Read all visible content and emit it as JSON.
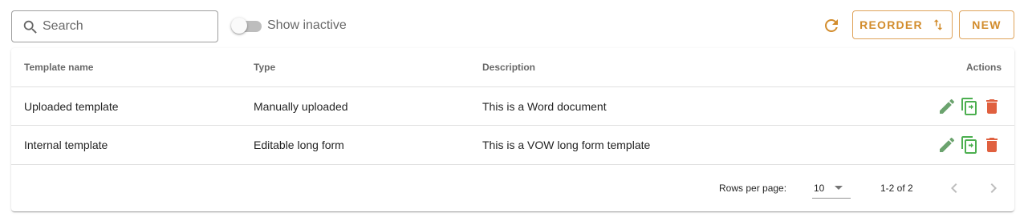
{
  "toolbar": {
    "search_placeholder": "Search",
    "search_value": "",
    "show_inactive_label": "Show inactive",
    "show_inactive_on": false,
    "reorder_label": "REORDER",
    "new_label": "NEW"
  },
  "table": {
    "columns": [
      "Template name",
      "Type",
      "Description",
      "Actions"
    ],
    "rows": [
      {
        "name": "Uploaded template",
        "type": "Manually uploaded",
        "description": "This is a Word document"
      },
      {
        "name": "Internal template",
        "type": "Editable long form",
        "description": "This is a VOW long form template"
      }
    ]
  },
  "pagination": {
    "rows_per_page_label": "Rows per page:",
    "rows_per_page": "10",
    "range": "1-2 of 2"
  },
  "icons": {
    "search": "search-icon",
    "refresh": "refresh-icon",
    "reorder": "swap-vertical-icon",
    "edit": "pencil-icon",
    "copy": "copy-icon",
    "delete": "trash-icon",
    "prev": "chevron-left-icon",
    "next": "chevron-right-icon"
  },
  "colors": {
    "accent": "#d28c2c",
    "edit": "#6ba36e",
    "copy": "#4caf50",
    "delete": "#e0603f"
  }
}
